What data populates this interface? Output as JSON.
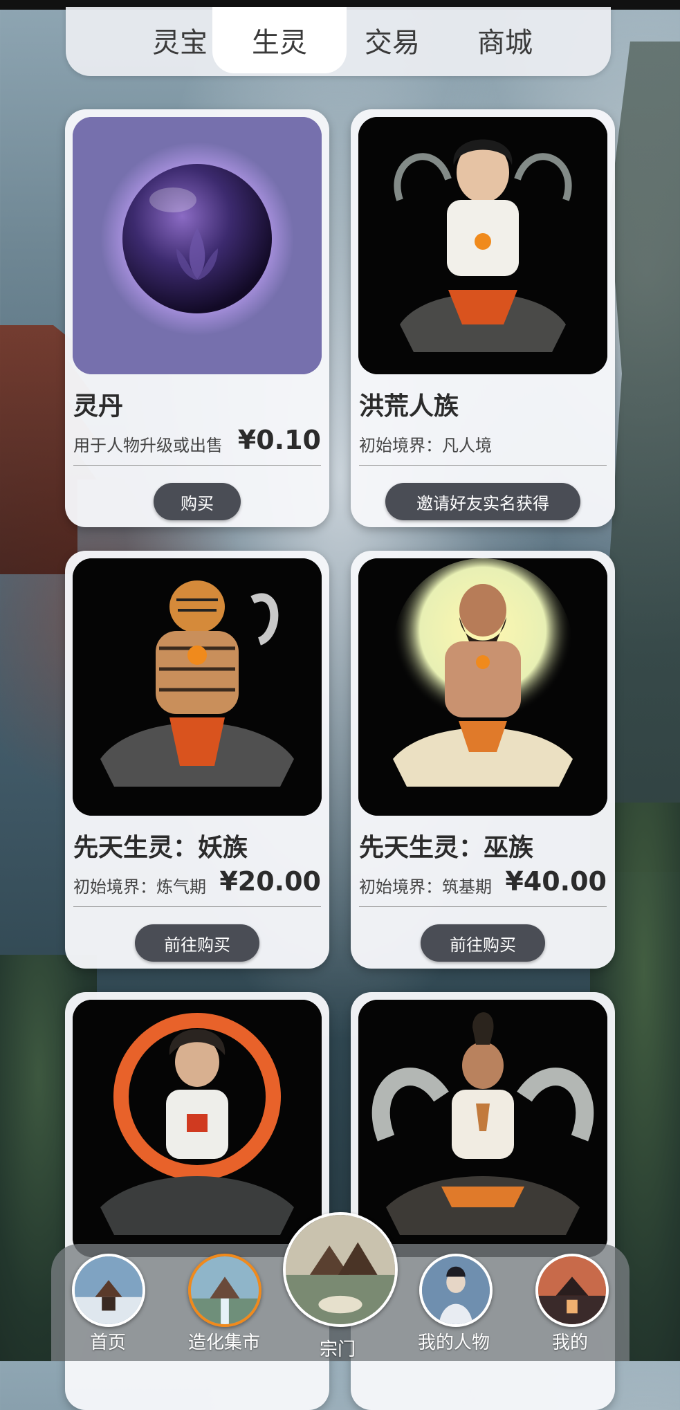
{
  "tabs": [
    {
      "label": "灵宝",
      "active": false
    },
    {
      "label": "生灵",
      "active": true
    },
    {
      "label": "交易",
      "active": false
    },
    {
      "label": "商城",
      "active": false
    }
  ],
  "cards": [
    {
      "title": "灵丹",
      "subtitle": "用于人物升级或出售",
      "price": "¥0.10",
      "button": "购买",
      "image": "purple-orb"
    },
    {
      "title": "洪荒人族",
      "subtitle": "初始境界：凡人境",
      "price": "",
      "button": "邀请好友实名获得",
      "image": "meditating-human"
    },
    {
      "title": "先天生灵：妖族",
      "subtitle": "初始境界：炼气期",
      "price": "¥20.00",
      "button": "前往购买",
      "image": "meditating-tiger"
    },
    {
      "title": "先天生灵：巫族",
      "subtitle": "初始境界：筑基期",
      "price": "¥40.00",
      "button": "前往购买",
      "image": "meditating-shaman"
    },
    {
      "title": "",
      "subtitle": "",
      "price": "",
      "button": "",
      "image": "meditating-warrior"
    },
    {
      "title": "",
      "subtitle": "",
      "price": "",
      "button": "",
      "image": "meditating-monk"
    }
  ],
  "bottom_nav": [
    {
      "label": "首页",
      "icon": "home-avatar"
    },
    {
      "label": "造化集市",
      "icon": "market-avatar",
      "selected": true
    },
    {
      "label": "宗门",
      "icon": "sect-avatar"
    },
    {
      "label": "我的人物",
      "icon": "character-avatar"
    },
    {
      "label": "我的",
      "icon": "profile-avatar"
    }
  ],
  "colors": {
    "button_bg": "#4a4d55",
    "nav_selected_ring": "#f08a1c",
    "card_bg": "#f6f7fa"
  }
}
